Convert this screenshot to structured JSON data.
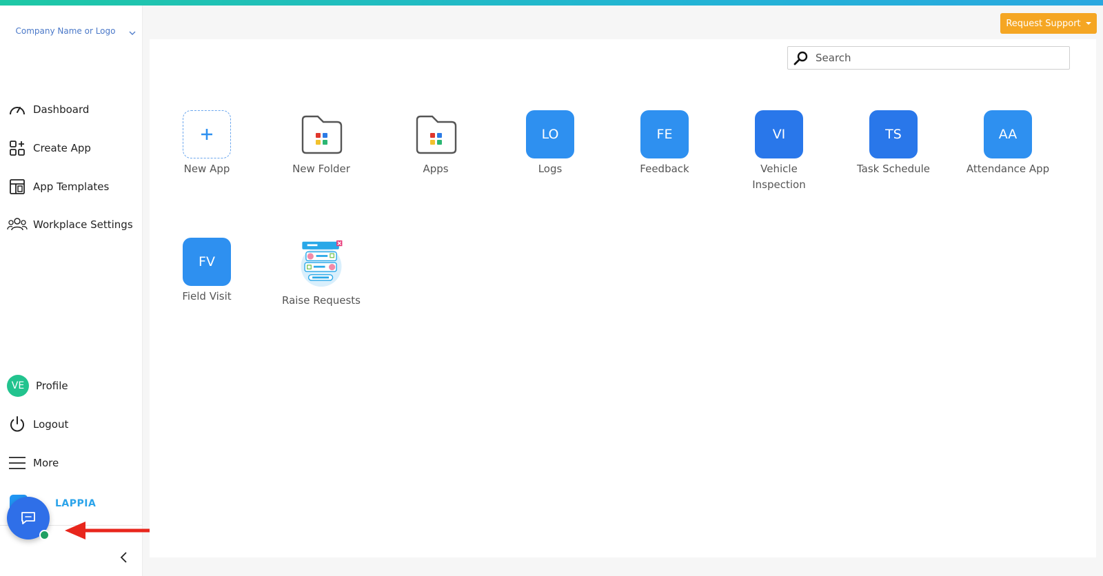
{
  "sidebar": {
    "company_label": "Company Name or Logo",
    "nav": [
      {
        "label": "Dashboard",
        "icon": "gauge-icon"
      },
      {
        "label": "Create App",
        "icon": "grid-plus-icon"
      },
      {
        "label": "App Templates",
        "icon": "layout-icon"
      },
      {
        "label": "Workplace Settings",
        "icon": "users-icon"
      }
    ],
    "profile": {
      "initials": "VE",
      "label": "Profile"
    },
    "logout_label": "Logout",
    "more_label": "More",
    "brand_text": "LAPPIA"
  },
  "header": {
    "request_support_label": "Request Support"
  },
  "search": {
    "placeholder": "Search",
    "value": ""
  },
  "tiles": [
    {
      "label": "New App",
      "kind": "add"
    },
    {
      "label": "New Folder",
      "kind": "folder"
    },
    {
      "label": "Apps",
      "kind": "folder"
    },
    {
      "label": "Logs",
      "initials": "LO"
    },
    {
      "label": "Feedback",
      "initials": "FE"
    },
    {
      "label": "Vehicle Inspection",
      "initials": "VI"
    },
    {
      "label": "Task Schedule",
      "initials": "TS"
    },
    {
      "label": "Attendance App",
      "initials": "AA"
    },
    {
      "label": "Field Visit",
      "initials": "FV"
    },
    {
      "label": "Raise Requests",
      "kind": "illustration"
    }
  ],
  "colors": {
    "accent": "#2e90f0",
    "support_button": "#f5a623",
    "avatar": "#22c38e",
    "chat_fab": "#2f6fe8",
    "arrow": "#e8261c"
  }
}
